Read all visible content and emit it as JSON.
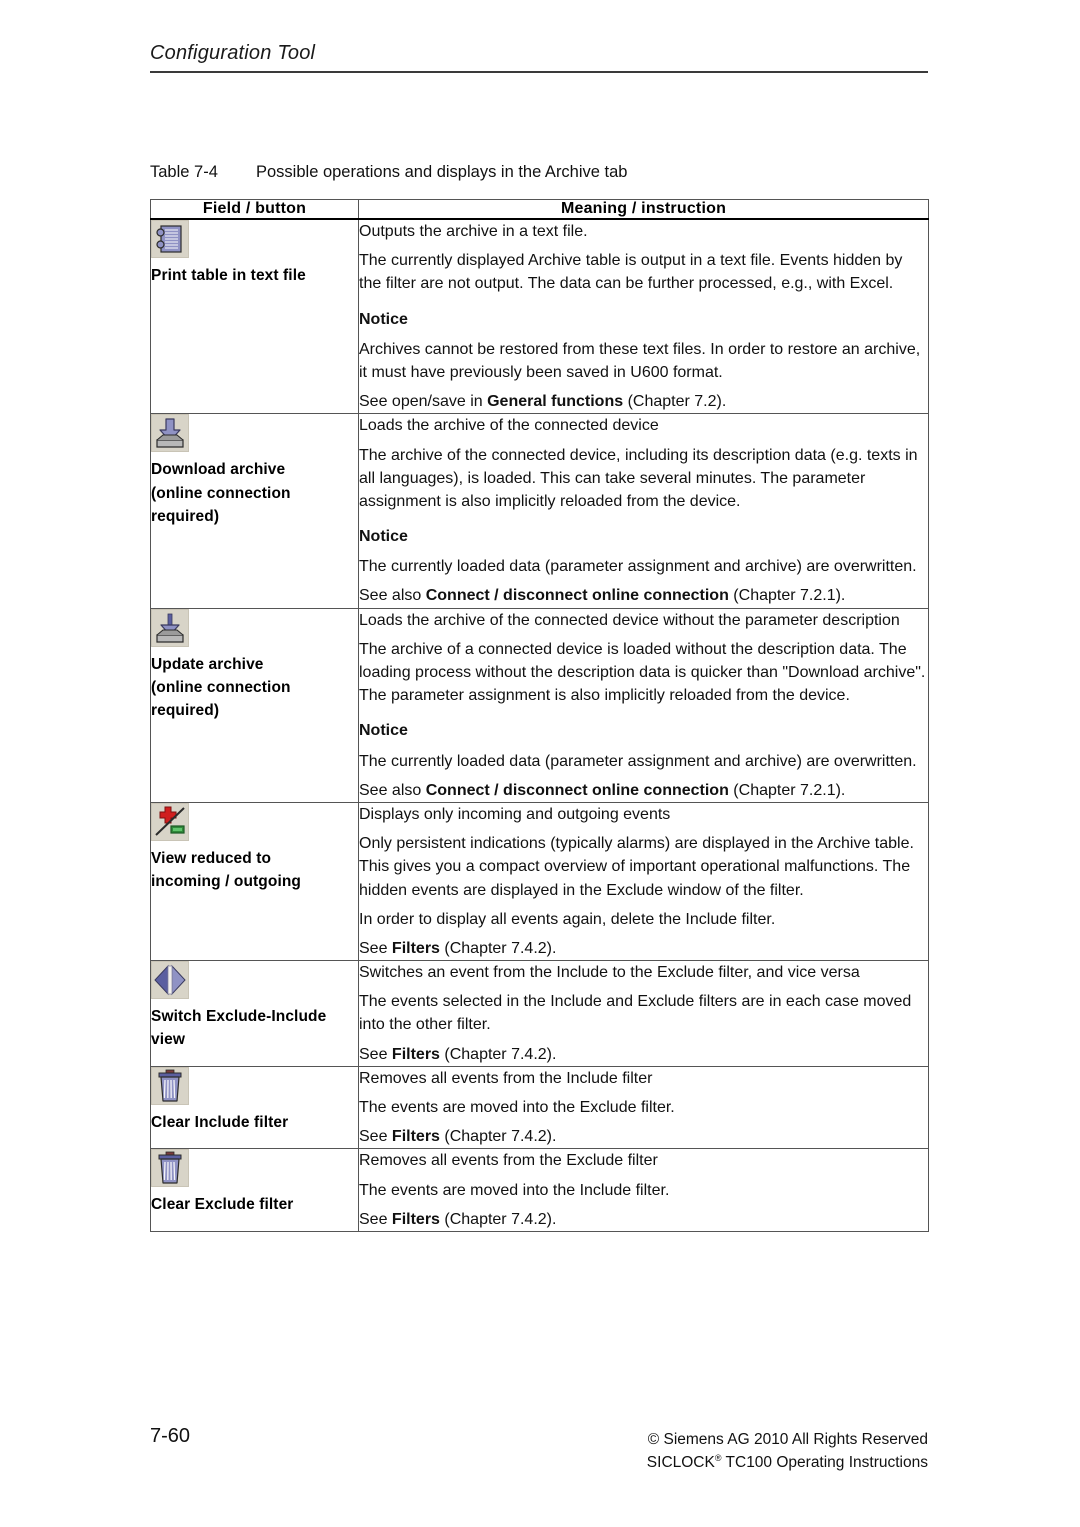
{
  "header": {
    "title": "Configuration Tool"
  },
  "table_caption": {
    "number": "Table 7-4",
    "text": "Possible operations and displays in the Archive tab"
  },
  "table": {
    "headers": {
      "field": "Field / button",
      "meaning": "Meaning / instruction"
    },
    "rows": [
      {
        "icon": "print-table-icon",
        "label_lines": [
          "Print table in text file"
        ],
        "paragraphs": [
          {
            "kind": "plain",
            "text": "Outputs the archive in a text file."
          },
          {
            "kind": "plain",
            "text": "The currently displayed Archive table is output in a text file. Events hidden by the filter are not output. The data can be further processed, e.g., with Excel."
          },
          {
            "kind": "notice",
            "text": "Notice"
          },
          {
            "kind": "plain",
            "text": "Archives cannot be restored from these text files. In order to restore an archive, it must have previously been saved in U600 format."
          },
          {
            "kind": "mixed",
            "pre": "See open/save in ",
            "bold": "General functions",
            "post": " (Chapter 7.2)."
          }
        ]
      },
      {
        "icon": "download-archive-icon",
        "label_lines": [
          "Download archive",
          "(online connection",
          "required)"
        ],
        "paragraphs": [
          {
            "kind": "plain",
            "text": "Loads the archive of the connected device"
          },
          {
            "kind": "plain",
            "text": "The archive of the connected device, including its description data (e.g. texts in all languages), is loaded. This can take several minutes. The parameter assignment is also implicitly reloaded from the device."
          },
          {
            "kind": "notice",
            "text": "Notice"
          },
          {
            "kind": "plain",
            "text": "The currently loaded data (parameter assignment and archive) are overwritten."
          },
          {
            "kind": "mixed",
            "pre": "See also ",
            "bold": "Connect / disconnect online connection",
            "post": " (Chapter 7.2.1)."
          }
        ]
      },
      {
        "icon": "update-archive-icon",
        "label_lines": [
          "Update archive",
          "(online connection",
          "required)"
        ],
        "paragraphs": [
          {
            "kind": "plain",
            "text": "Loads the archive of the connected device without the parameter description"
          },
          {
            "kind": "plain",
            "text": "The archive of a connected device is loaded without the description data. The loading process without the description data is quicker than \"Download archive\". The parameter assignment is also implicitly reloaded from the device."
          },
          {
            "kind": "notice",
            "text": "Notice"
          },
          {
            "kind": "plain",
            "text": "The currently loaded data (parameter assignment and archive) are overwritten."
          },
          {
            "kind": "mixed",
            "pre": "See also ",
            "bold": "Connect / disconnect online connection",
            "post": " (Chapter 7.2.1)."
          }
        ]
      },
      {
        "icon": "view-reduced-incoming-outgoing-icon",
        "label_lines": [
          "View reduced to",
          "incoming / outgoing"
        ],
        "paragraphs": [
          {
            "kind": "plain",
            "text": "Displays only incoming and outgoing events"
          },
          {
            "kind": "plain",
            "text": "Only persistent indications (typically alarms) are displayed in the Archive table. This gives you a compact overview of important operational malfunctions. The hidden events are displayed in the Exclude window of the filter."
          },
          {
            "kind": "plain",
            "text": "In order to display all events again, delete the Include filter."
          },
          {
            "kind": "mixed",
            "pre": "See ",
            "bold": "Filters",
            "post": " (Chapter 7.4.2)."
          }
        ]
      },
      {
        "icon": "switch-exclude-include-icon",
        "label_lines": [
          "Switch Exclude-Include",
          "view"
        ],
        "paragraphs": [
          {
            "kind": "plain",
            "text": "Switches an event from the Include to the Exclude filter, and vice versa"
          },
          {
            "kind": "plain",
            "text": "The events selected in the Include and Exclude filters are in each case moved into the other filter."
          },
          {
            "kind": "mixed",
            "pre": "See ",
            "bold": "Filters",
            "post": " (Chapter 7.4.2)."
          }
        ]
      },
      {
        "icon": "clear-include-filter-icon",
        "label_lines": [
          "Clear Include filter"
        ],
        "paragraphs": [
          {
            "kind": "plain",
            "text": "Removes all events from the Include filter"
          },
          {
            "kind": "plain",
            "text": "The events are moved into the Exclude filter."
          },
          {
            "kind": "mixed",
            "pre": "See ",
            "bold": "Filters",
            "post": " (Chapter 7.4.2)."
          }
        ]
      },
      {
        "icon": "clear-exclude-filter-icon",
        "label_lines": [
          "Clear Exclude filter"
        ],
        "paragraphs": [
          {
            "kind": "plain",
            "text": "Removes all events from the Exclude filter"
          },
          {
            "kind": "plain",
            "text": "The events are moved into the Include filter."
          },
          {
            "kind": "mixed",
            "pre": "See ",
            "bold": "Filters",
            "post": " (Chapter 7.4.2)."
          }
        ]
      }
    ]
  },
  "footer": {
    "page_number": "7-60",
    "copyright": "© Siemens AG 2010 All Rights Reserved",
    "product_pre": "SICLOCK",
    "product_sup": "®",
    "product_post": " TC100 Operating Instructions"
  },
  "colors": {
    "icon_background": "#d8d4c8",
    "icon_blue": "#8f92c4",
    "icon_blue_dark": "#5b5fa0",
    "icon_red": "#d01f1f",
    "icon_green": "#2f8a3a",
    "rule": "#3a3a3a"
  }
}
